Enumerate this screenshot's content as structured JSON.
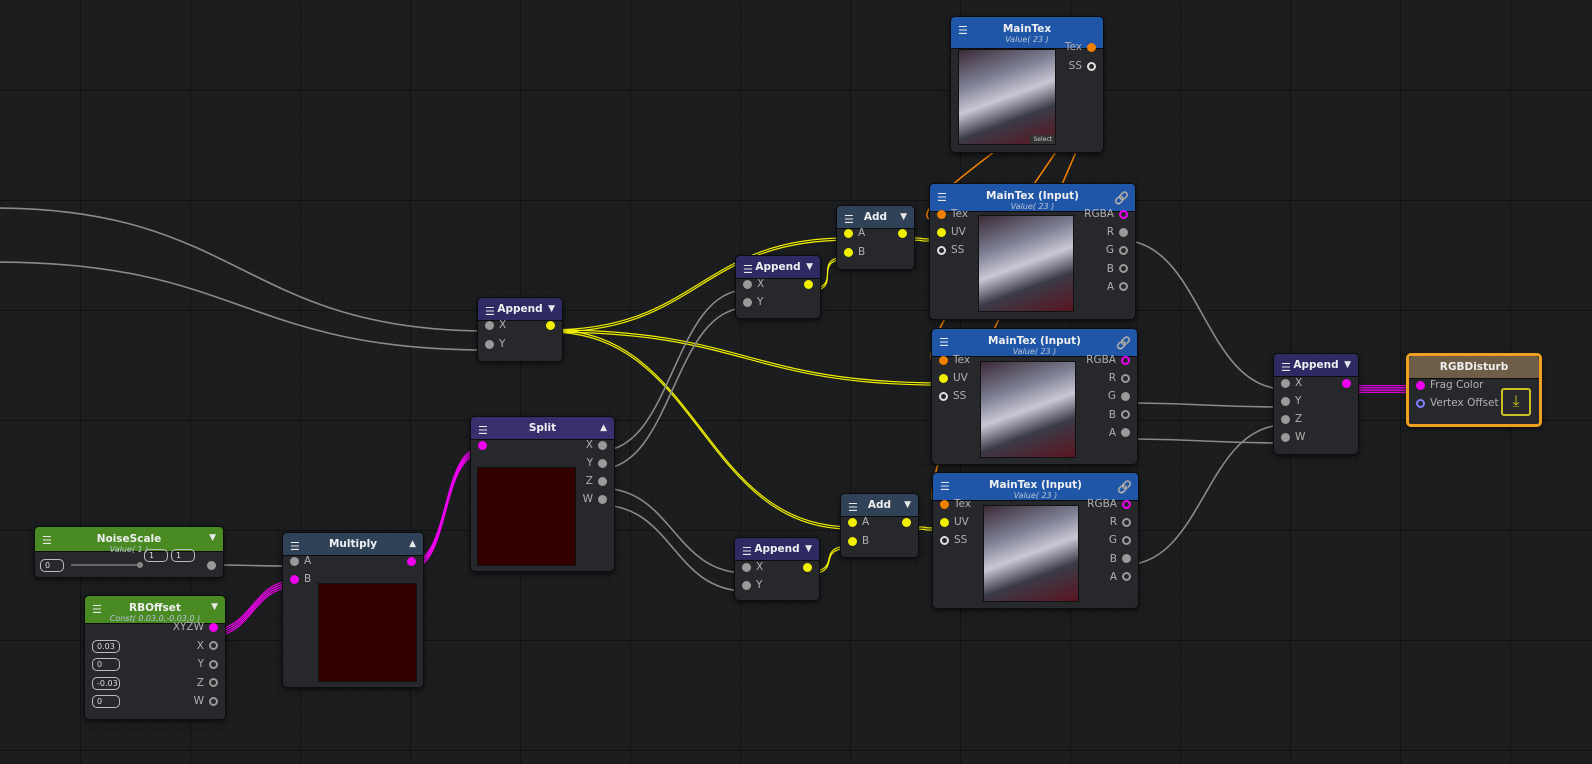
{
  "colors": {
    "tex": "#f08000",
    "float": "#9a9a9a",
    "vec2": "#f0f000",
    "vec4": "#f000f0",
    "ss": "#e0e0e0",
    "vert": "#8080ff",
    "hdr_blue": "#1f56a8",
    "hdr_purple": "#2e2a63",
    "hdr_split": "#3a2f6e",
    "hdr_steel": "#2f4258",
    "hdr_green": "#4a8a22",
    "hdr_master": "#6e5e48",
    "selection": "#f0a020"
  },
  "nodes": {
    "maintex": {
      "title": "MainTex",
      "subtitle": "Value( 23 )",
      "header": "hdr_blue",
      "select_label": "Select",
      "inputs": [],
      "outputs": [
        {
          "label": "Tex",
          "type": "tex"
        },
        {
          "label": "SS",
          "type": "ss",
          "hollow": true
        }
      ]
    },
    "tex1": {
      "title": "MainTex (Input)",
      "subtitle": "Value( 23 )",
      "header": "hdr_blue",
      "icon": "link-icon",
      "inputs": [
        {
          "label": "Tex",
          "type": "tex"
        },
        {
          "label": "UV",
          "type": "vec2"
        },
        {
          "label": "SS",
          "type": "ss",
          "hollow": true
        }
      ],
      "outputs": [
        {
          "label": "RGBA",
          "type": "vec4",
          "hollow": true
        },
        {
          "label": "R",
          "type": "float"
        },
        {
          "label": "G",
          "type": "float",
          "hollow": true
        },
        {
          "label": "B",
          "type": "float",
          "hollow": true
        },
        {
          "label": "A",
          "type": "float",
          "hollow": true
        }
      ]
    },
    "tex2": {
      "title": "MainTex (Input)",
      "subtitle": "Value( 23 )",
      "header": "hdr_blue",
      "icon": "link-icon",
      "inputs": [
        {
          "label": "Tex",
          "type": "tex"
        },
        {
          "label": "UV",
          "type": "vec2"
        },
        {
          "label": "SS",
          "type": "ss",
          "hollow": true
        }
      ],
      "outputs": [
        {
          "label": "RGBA",
          "type": "vec4",
          "hollow": true
        },
        {
          "label": "R",
          "type": "float",
          "hollow": true
        },
        {
          "label": "G",
          "type": "float"
        },
        {
          "label": "B",
          "type": "float",
          "hollow": true
        },
        {
          "label": "A",
          "type": "float"
        }
      ]
    },
    "tex3": {
      "title": "MainTex (Input)",
      "subtitle": "Value( 23 )",
      "header": "hdr_blue",
      "icon": "link-icon",
      "inputs": [
        {
          "label": "Tex",
          "type": "tex"
        },
        {
          "label": "UV",
          "type": "vec2"
        },
        {
          "label": "SS",
          "type": "ss",
          "hollow": true
        }
      ],
      "outputs": [
        {
          "label": "RGBA",
          "type": "vec4",
          "hollow": true
        },
        {
          "label": "R",
          "type": "float",
          "hollow": true
        },
        {
          "label": "G",
          "type": "float",
          "hollow": true
        },
        {
          "label": "B",
          "type": "float"
        },
        {
          "label": "A",
          "type": "float",
          "hollow": true
        }
      ]
    },
    "add1": {
      "title": "Add",
      "header": "hdr_steel",
      "arrow": "▼",
      "inputs": [
        {
          "label": "A",
          "type": "vec2"
        },
        {
          "label": "B",
          "type": "vec2"
        }
      ],
      "outputs": [
        {
          "label": "",
          "type": "vec2"
        }
      ]
    },
    "add2": {
      "title": "Add",
      "header": "hdr_steel",
      "arrow": "▼",
      "inputs": [
        {
          "label": "A",
          "type": "vec2"
        },
        {
          "label": "B",
          "type": "vec2"
        }
      ],
      "outputs": [
        {
          "label": "",
          "type": "vec2"
        }
      ]
    },
    "append1": {
      "title": "Append",
      "header": "hdr_purple",
      "arrow": "▼",
      "inputs": [
        {
          "label": "X",
          "type": "float"
        },
        {
          "label": "Y",
          "type": "float"
        }
      ],
      "outputs": [
        {
          "label": "",
          "type": "vec2"
        }
      ]
    },
    "append2": {
      "title": "Append",
      "header": "hdr_purple",
      "arrow": "▼",
      "inputs": [
        {
          "label": "X",
          "type": "float"
        },
        {
          "label": "Y",
          "type": "float"
        }
      ],
      "outputs": [
        {
          "label": "",
          "type": "vec2"
        }
      ]
    },
    "append3": {
      "title": "Append",
      "header": "hdr_purple",
      "arrow": "▼",
      "inputs": [
        {
          "label": "X",
          "type": "float"
        },
        {
          "label": "Y",
          "type": "float"
        }
      ],
      "outputs": [
        {
          "label": "",
          "type": "vec2"
        }
      ]
    },
    "split": {
      "title": "Split",
      "header": "hdr_split",
      "arrow": "▲",
      "inputs": [
        {
          "label": "",
          "type": "vec4"
        }
      ],
      "outputs": [
        {
          "label": "X",
          "type": "float"
        },
        {
          "label": "Y",
          "type": "float"
        },
        {
          "label": "Z",
          "type": "float"
        },
        {
          "label": "W",
          "type": "float"
        }
      ]
    },
    "multiply": {
      "title": "Multiply",
      "header": "hdr_steel",
      "arrow": "▲",
      "inputs": [
        {
          "label": "A",
          "type": "float"
        },
        {
          "label": "B",
          "type": "vec4"
        }
      ],
      "outputs": [
        {
          "label": "",
          "type": "vec4"
        }
      ]
    },
    "noisescale": {
      "title": "NoiseScale",
      "subtitle": "Value( 1 )",
      "header": "hdr_green",
      "arrow": "▼",
      "inputs": [],
      "outputs": [],
      "fields": [
        "0",
        "1",
        "1"
      ],
      "slider_value": 1
    },
    "rboffset": {
      "title": "RBOffset",
      "subtitle": "Const( 0.03,0,-0.03,0 )",
      "header": "hdr_green",
      "arrow": "▼",
      "inputs": [],
      "outputs": [
        {
          "label": "XYZW",
          "type": "vec4"
        },
        {
          "label": "X",
          "type": "float",
          "hollow": true
        },
        {
          "label": "Y",
          "type": "float",
          "hollow": true
        },
        {
          "label": "Z",
          "type": "float",
          "hollow": true
        },
        {
          "label": "W",
          "type": "float",
          "hollow": true
        }
      ],
      "fields": [
        "0.03",
        "0",
        "-0.03",
        "0"
      ]
    },
    "append4": {
      "title": "Append",
      "header": "hdr_purple",
      "arrow": "▼",
      "inputs": [
        {
          "label": "X",
          "type": "float"
        },
        {
          "label": "Y",
          "type": "float"
        },
        {
          "label": "Z",
          "type": "float"
        },
        {
          "label": "W",
          "type": "float"
        }
      ],
      "outputs": [
        {
          "label": "",
          "type": "vec4"
        }
      ]
    },
    "master": {
      "title": "RGBDisturb",
      "header": "hdr_master",
      "selected": true,
      "icon": "save-icon",
      "inputs": [
        {
          "label": "Frag Color",
          "type": "vec4"
        },
        {
          "label": "Vertex Offset",
          "type": "vert",
          "hollow": true
        }
      ],
      "outputs": []
    }
  }
}
